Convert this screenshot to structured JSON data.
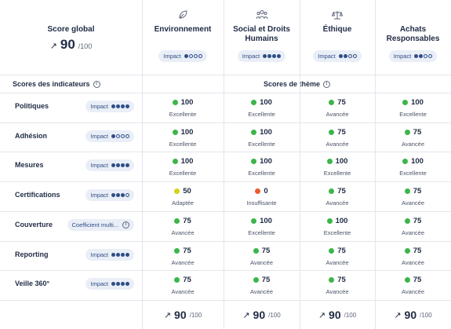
{
  "global": {
    "title": "Score global",
    "score": "90",
    "denominator": "/100",
    "arrow": "↗"
  },
  "themes": [
    {
      "name": "Environnement",
      "icon": "leaf-icon",
      "impact_label": "Impact",
      "impact_level": 1
    },
    {
      "name": "Social et Droits Humains",
      "icon": "people-icon",
      "impact_label": "Impact",
      "impact_level": 4
    },
    {
      "name": "Éthique",
      "icon": "scales-icon",
      "impact_label": "Impact",
      "impact_level": 2
    },
    {
      "name": "Achats Responsables",
      "icon": "",
      "impact_label": "Impact",
      "impact_level": 2
    }
  ],
  "sections": {
    "indicators_label": "Scores des indicateurs",
    "themes_label": "Scores de thème"
  },
  "rows": [
    {
      "label": "Politiques",
      "pill": "Impact",
      "impact_level": 4,
      "cells": [
        {
          "score": "100",
          "level": "Excellente",
          "status": "green"
        },
        {
          "score": "100",
          "level": "Excellente",
          "status": "green"
        },
        {
          "score": "75",
          "level": "Avancée",
          "status": "green"
        },
        {
          "score": "100",
          "level": "Excellente",
          "status": "green"
        }
      ]
    },
    {
      "label": "Adhésion",
      "pill": "Impact",
      "impact_level": 1,
      "cells": [
        {
          "score": "100",
          "level": "Excellente",
          "status": "green"
        },
        {
          "score": "100",
          "level": "Excellente",
          "status": "green"
        },
        {
          "score": "75",
          "level": "Avancée",
          "status": "green"
        },
        {
          "score": "75",
          "level": "Avancée",
          "status": "green"
        }
      ]
    },
    {
      "label": "Mesures",
      "pill": "Impact",
      "impact_level": 4,
      "cells": [
        {
          "score": "100",
          "level": "Excellente",
          "status": "green"
        },
        {
          "score": "100",
          "level": "Excellente",
          "status": "green"
        },
        {
          "score": "100",
          "level": "Excellente",
          "status": "green"
        },
        {
          "score": "100",
          "level": "Excellente",
          "status": "green"
        }
      ]
    },
    {
      "label": "Certifications",
      "pill": "Impact",
      "impact_level": 3,
      "cells": [
        {
          "score": "50",
          "level": "Adaptée",
          "status": "yellow"
        },
        {
          "score": "0",
          "level": "Insuffisante",
          "status": "red"
        },
        {
          "score": "75",
          "level": "Avancée",
          "status": "green"
        },
        {
          "score": "75",
          "level": "Avancée",
          "status": "green"
        }
      ]
    },
    {
      "label": "Couverture",
      "pill": "Coefficient multi...",
      "impact_level": 0,
      "cells": [
        {
          "score": "75",
          "level": "Avancée",
          "status": "green"
        },
        {
          "score": "100",
          "level": "Excellente",
          "status": "green"
        },
        {
          "score": "100",
          "level": "Excellente",
          "status": "green"
        },
        {
          "score": "75",
          "level": "Avancée",
          "status": "green"
        }
      ]
    },
    {
      "label": "Reporting",
      "pill": "Impact",
      "impact_level": 4,
      "cells": [
        {
          "score": "75",
          "level": "Avancée",
          "status": "green"
        },
        {
          "score": "75",
          "level": "Avancée",
          "status": "green"
        },
        {
          "score": "75",
          "level": "Avancée",
          "status": "green"
        },
        {
          "score": "75",
          "level": "Avancée",
          "status": "green"
        }
      ]
    },
    {
      "label": "Veille 360°",
      "pill": "Impact",
      "impact_level": 4,
      "cells": [
        {
          "score": "75",
          "level": "Avancée",
          "status": "green"
        },
        {
          "score": "75",
          "level": "Avancée",
          "status": "green"
        },
        {
          "score": "75",
          "level": "Avancée",
          "status": "green"
        },
        {
          "score": "75",
          "level": "Avancée",
          "status": "green"
        }
      ]
    }
  ],
  "footer": [
    {
      "arrow": "↗",
      "score": "90",
      "den": "/100"
    },
    {
      "arrow": "↗",
      "score": "90",
      "den": "/100"
    },
    {
      "arrow": "↗",
      "score": "90",
      "den": "/100"
    },
    {
      "arrow": "↗",
      "score": "90",
      "den": "/100"
    }
  ],
  "colors": {
    "green": "#3cb54a",
    "yellow": "#d4d317",
    "red": "#ec5b2c",
    "pill_bg": "#e9eef7",
    "accent": "#2f4d86"
  }
}
